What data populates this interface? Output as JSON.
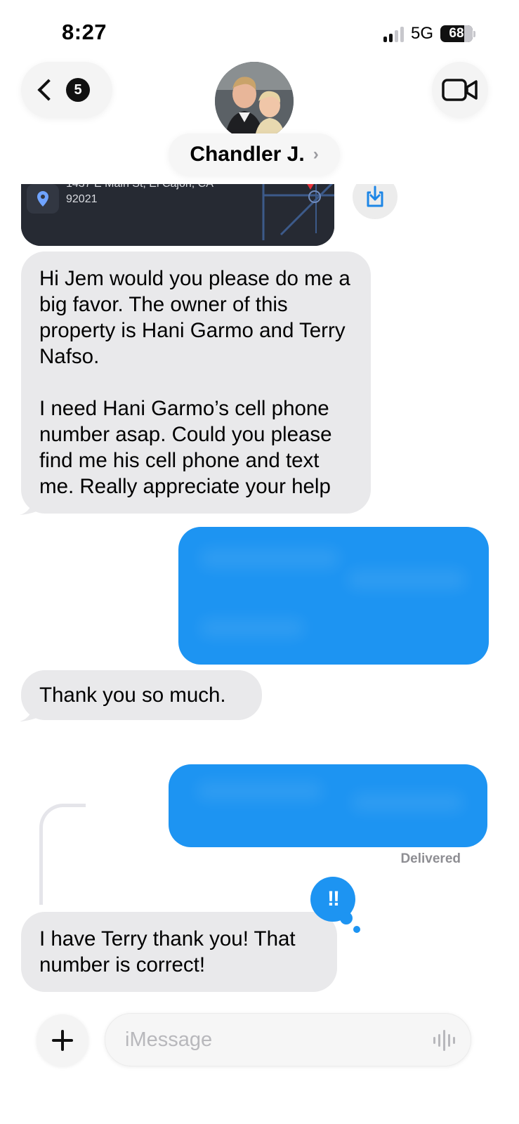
{
  "status_bar": {
    "time": "8:27",
    "network": "5G",
    "battery": "68"
  },
  "header": {
    "back_count": "5",
    "contact_name": "Chandler J.",
    "chevron": "›"
  },
  "location_card": {
    "street": "1437 E Main St, El Cajon, CA",
    "zip": "92021"
  },
  "messages": [
    {
      "direction": "incoming",
      "text": "Hi Jem would you please do me a big favor. The owner of this property is Hani Garmo and Terry Nafso.\n\nI need Hani Garmo’s cell phone number asap. Could you please find me his cell phone and text me. Really appreciate your help"
    },
    {
      "direction": "incoming",
      "text": "Thank you so much."
    },
    {
      "direction": "incoming",
      "text": "I have Terry thank you! That number is correct!"
    }
  ],
  "delivery_status": "Delivered",
  "tapback": "!!",
  "composer": {
    "placeholder": "iMessage"
  },
  "colors": {
    "outgoing_bubble": "#1d94f2",
    "incoming_bubble": "#e9e9eb",
    "background": "#ffffff"
  }
}
